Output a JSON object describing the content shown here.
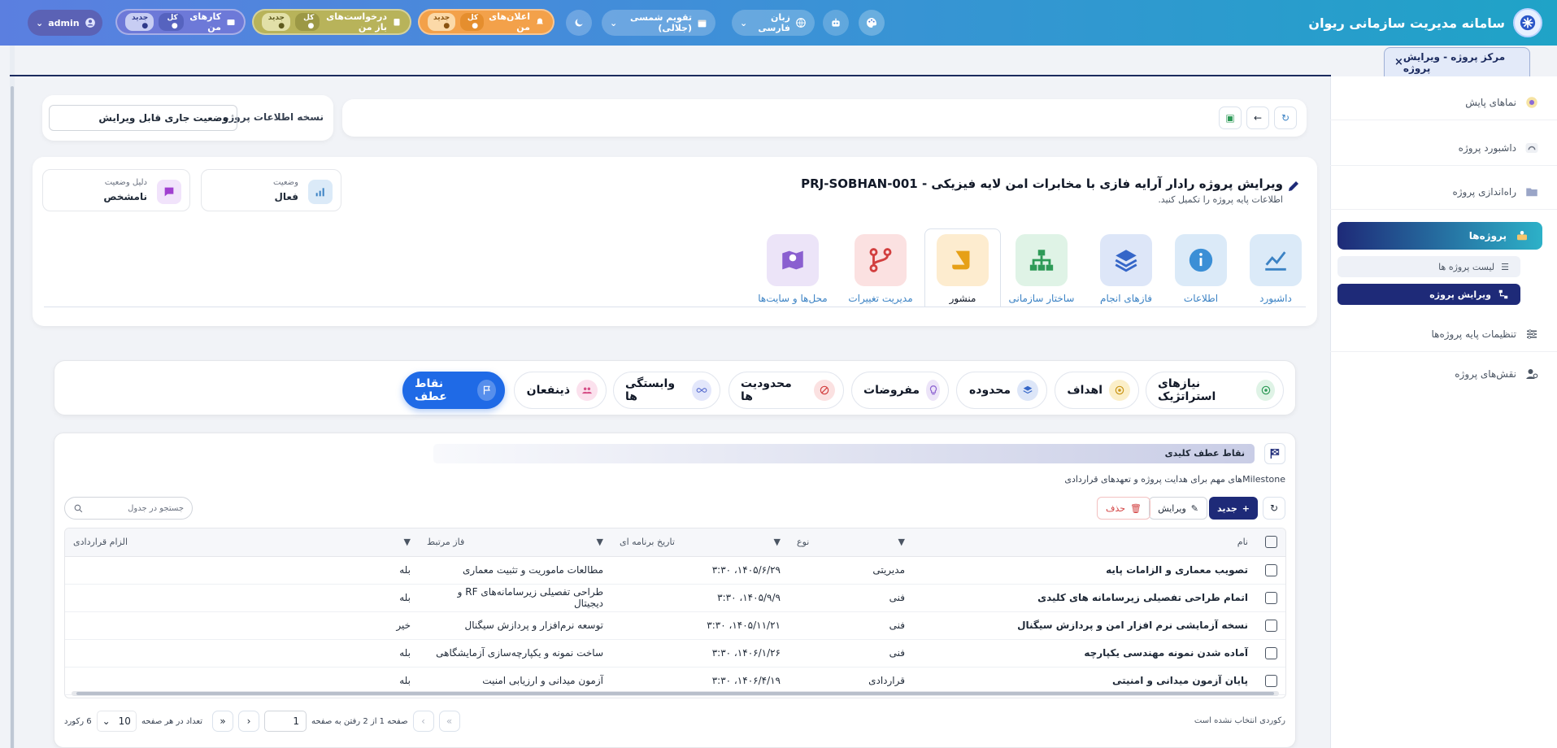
{
  "app": {
    "title": "سامانه مدیریت سازمانی ریوان",
    "admin_label": "admin"
  },
  "topbar": {
    "pills": [
      {
        "label": "اعلان‌های من",
        "chip_all": "کل",
        "chip_new": "جدید",
        "color": "#f3a14a"
      },
      {
        "label": "درخواست‌های باز من",
        "chip_all": "کل",
        "chip_new": "جدید",
        "color": "#b8b35a"
      },
      {
        "label": "کارهای من",
        "chip_all": "کل",
        "chip_new": "جدید",
        "color": "#6d79d8"
      }
    ],
    "calendar": "تقویم  شمسی (جلالی)",
    "language": "زبان  فارسی"
  },
  "doc_tab": {
    "label": "مرکز پروژه  -  ویرایش پروژه",
    "close": "×"
  },
  "sidebar": {
    "items": [
      {
        "label": "نماهای پایش"
      },
      {
        "label": "داشبورد پروژه"
      },
      {
        "label": "راه‌اندازی پروژه"
      }
    ],
    "active": "پروژه‌ها",
    "subs": [
      {
        "label": "لیست پروژه ها"
      },
      {
        "label": "ویرایش پروژه"
      }
    ],
    "bottom": [
      {
        "label": "تنظیمات پایه پروژه‌ها"
      },
      {
        "label": "نقش‌های پروژه"
      }
    ]
  },
  "version": {
    "label": "نسخه اطلاعات پروژه",
    "value": "وضعیت جاری قابل ویرایش"
  },
  "project": {
    "title": "ویرایش پروژه رادار آرایه فازی با مخابرات امن لایه فیزیکی - PRJ-SOBHAN-001",
    "subtitle": "اطلاعات پایه پروژه را تکمیل کنید.",
    "status_label": "وضعیت",
    "status_value": "فعال",
    "reason_label": "دلیل وضعیت",
    "reason_value": "نامشخص"
  },
  "modules": [
    {
      "label": "داشبورد",
      "color": "#dbeaf8",
      "icon_color": "#3b82c4"
    },
    {
      "label": "اطلاعات",
      "color": "#dbeaf8",
      "icon_color": "#3b8fd6"
    },
    {
      "label": "فازهای انجام",
      "color": "#dde6f8",
      "icon_color": "#3566c8"
    },
    {
      "label": "ساختار سازمانی",
      "color": "#dff3e6",
      "icon_color": "#2e9a57"
    },
    {
      "label": "منشور",
      "color": "#fdeccf",
      "icon_color": "#e6a017"
    },
    {
      "label": "مدیریت تغییرات",
      "color": "#fbe1e1",
      "icon_color": "#d23f3f"
    },
    {
      "label": "محل‌ها و سایت‌ها",
      "color": "#ece4f8",
      "icon_color": "#8a5fd0"
    }
  ],
  "subtabs": [
    {
      "label": "نیازهای استراتژیک",
      "color": "#2e9a57"
    },
    {
      "label": "اهداف",
      "color": "#c99516"
    },
    {
      "label": "محدوده",
      "color": "#3566c8"
    },
    {
      "label": "مفروضات",
      "color": "#8a5fd0"
    },
    {
      "label": "محدودیت ها",
      "color": "#d23f3f"
    },
    {
      "label": "وابستگی ها",
      "color": "#5b6fd0"
    },
    {
      "label": "ذینفعان",
      "color": "#d64f87"
    },
    {
      "label": "نقاط عطف",
      "color": "#ffffff"
    }
  ],
  "section": {
    "title": "نقاط عطف کلیدی",
    "description": "Milestoneهای مهم برای هدایت پروژه و تعهدهای قراردادی"
  },
  "toolbar": {
    "new": "جدید",
    "edit": "ویرایش",
    "delete": "حذف",
    "search_placeholder": "جستجو در جدول"
  },
  "table": {
    "headers": [
      "نام",
      "نوع",
      "تاریخ برنامه ای",
      "فاز مرتبط",
      "الزام قراردادی"
    ],
    "rows": [
      [
        "تصویب معماری و الزامات پایه",
        "مدیریتی",
        "۱۴۰۵/۶/۲۹، ۳:۳۰",
        "مطالعات ماموریت و تثبیت معماری",
        "بله"
      ],
      [
        "اتمام طراحی تفصیلی زیرسامانه های کلیدی",
        "فنی",
        "۱۴۰۵/۹/۹، ۳:۳۰",
        "طراحی تفصیلی زیرسامانه‌های RF و دیجیتال",
        "بله"
      ],
      [
        "نسخه آزمایشی نرم افزار امن و پردازش سیگنال",
        "فنی",
        "۱۴۰۵/۱۱/۲۱، ۳:۳۰",
        "توسعه نرم‌افزار و پردازش سیگنال",
        "خیر"
      ],
      [
        "آماده شدن نمونه مهندسی یکپارچه",
        "فنی",
        "۱۴۰۶/۱/۲۶، ۳:۳۰",
        "ساخت نمونه و یکپارچه‌سازی آزمایشگاهی",
        "بله"
      ],
      [
        "پایان آزمون میدانی و امنیتی",
        "قراردادی",
        "۱۴۰۶/۴/۱۹، ۳:۳۰",
        "آزمون میدانی و ارزیابی امنیت",
        "بله"
      ]
    ]
  },
  "pager": {
    "no_selection": "رکوردی انتخاب نشده است",
    "page_info": "صفحه 1 از 2  رفتن به صفحه",
    "page_value": "1",
    "per_page_label": "تعداد در هر صفحه",
    "per_page": "10",
    "total": "6 رکورد",
    "first": "«",
    "prev": "‹",
    "next": "›",
    "last": "»"
  }
}
